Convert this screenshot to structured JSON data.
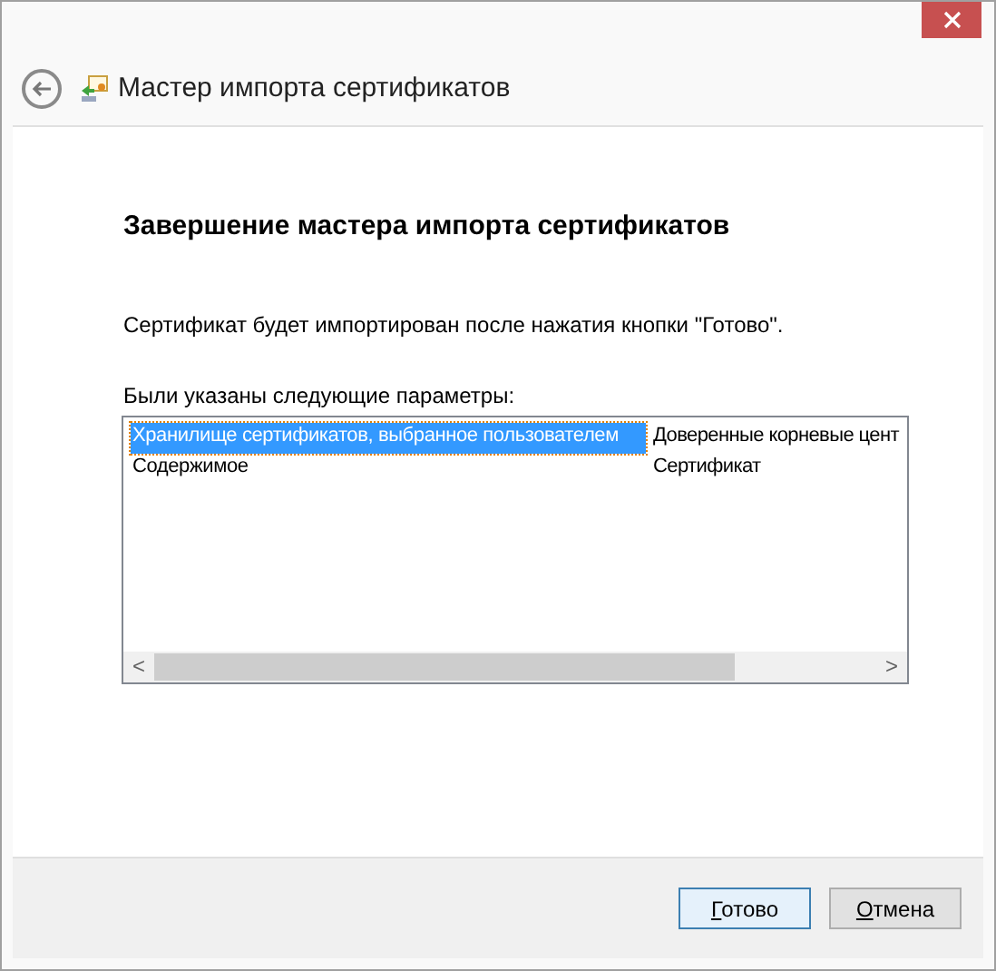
{
  "window": {
    "title": "Мастер импорта сертификатов"
  },
  "heading": "Завершение мастера импорта сертификатов",
  "description": "Сертификат будет импортирован после нажатия кнопки \"Готово\".",
  "params_label": "Были указаны следующие параметры:",
  "table": {
    "rows": [
      {
        "column_1": "Хранилище сертификатов, выбранное пользователем",
        "column_2": "Доверенные корневые цент",
        "selected": true
      },
      {
        "column_1": "Содержимое",
        "column_2": "Сертификат",
        "selected": false
      }
    ],
    "scrollbar": {
      "left": "<",
      "right": ">"
    }
  },
  "buttons": [
    {
      "label": "Готово",
      "kind": "default"
    },
    {
      "label": "Отмена",
      "kind": "normal"
    }
  ]
}
